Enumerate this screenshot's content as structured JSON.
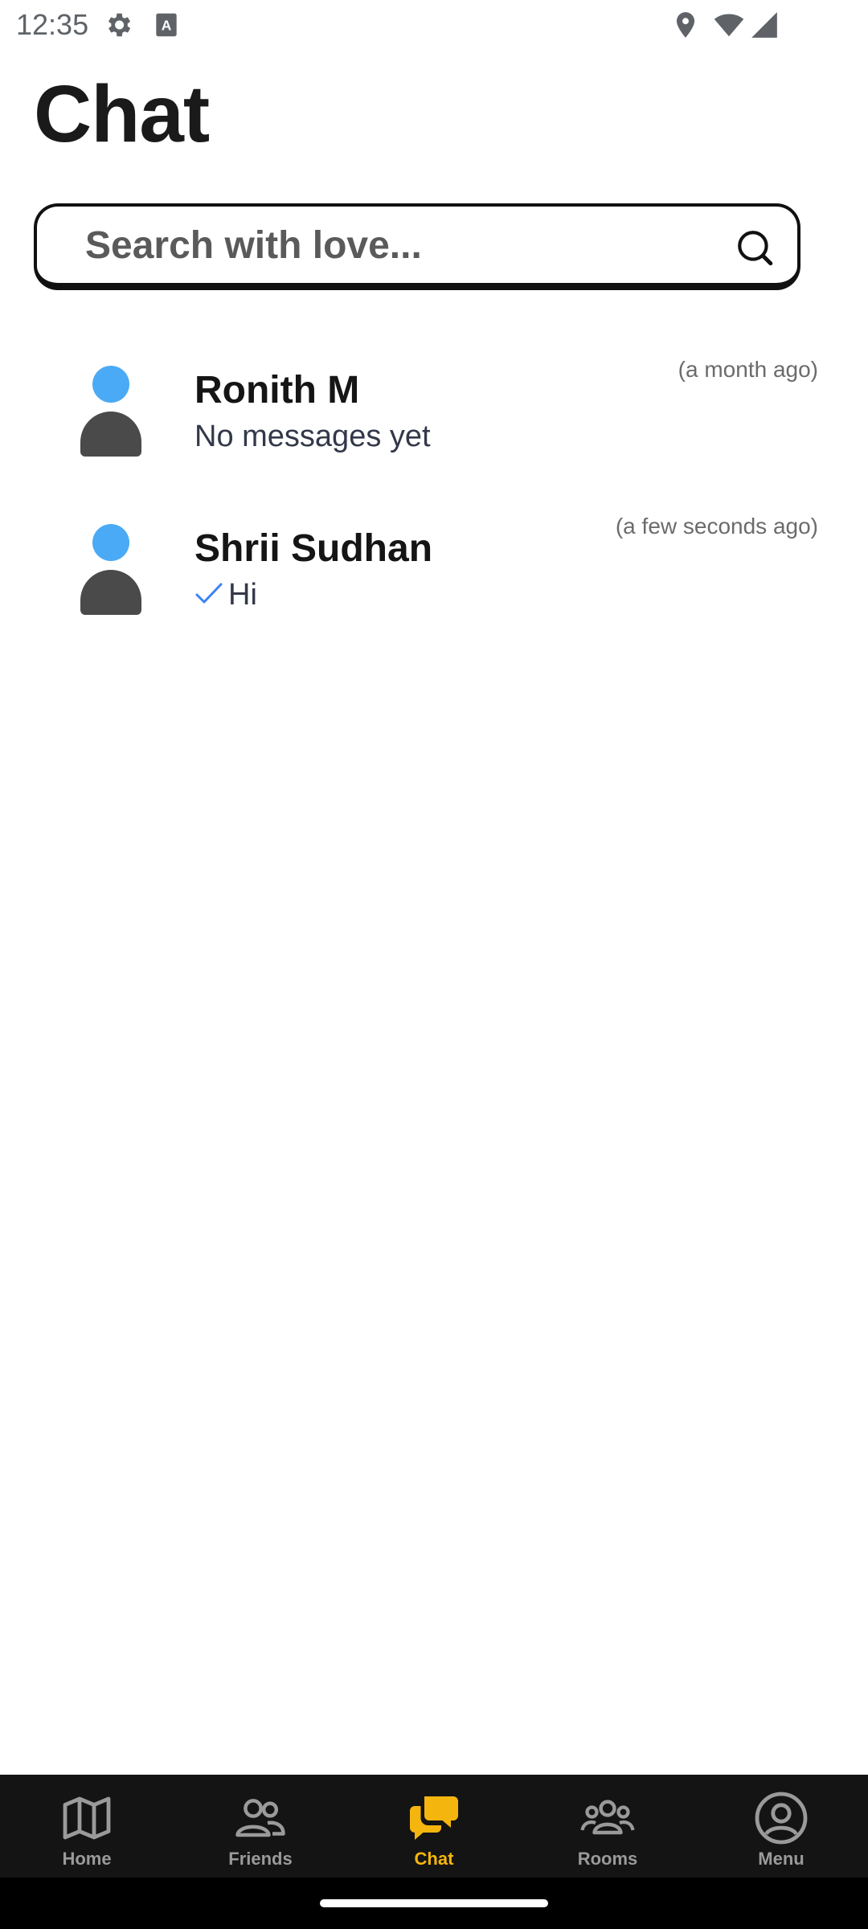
{
  "status_bar": {
    "time": "12:35",
    "icons": [
      "settings-icon",
      "keyboard-a-icon",
      "location-icon",
      "wifi-icon",
      "signal-icon"
    ]
  },
  "page": {
    "title": "Chat"
  },
  "search": {
    "placeholder": "Search with love...",
    "value": ""
  },
  "conversations": [
    {
      "name": "Ronith M",
      "preview": "No messages yet",
      "time": "(a month ago)",
      "read_check": false
    },
    {
      "name": "Shrii Sudhan",
      "preview": "Hi",
      "time": "(a few seconds ago)",
      "read_check": true
    }
  ],
  "nav": {
    "items": [
      {
        "label": "Home",
        "icon": "map-icon",
        "active": false
      },
      {
        "label": "Friends",
        "icon": "friends-icon",
        "active": false
      },
      {
        "label": "Chat",
        "icon": "chat-bubbles-icon",
        "active": true
      },
      {
        "label": "Rooms",
        "icon": "group-icon",
        "active": false
      },
      {
        "label": "Menu",
        "icon": "profile-circle-icon",
        "active": false
      }
    ]
  },
  "colors": {
    "accent": "#f5b50f",
    "nav_background": "#141414",
    "nav_inactive": "#9a9a9a",
    "avatar_head": "#4aaaf5",
    "avatar_body": "#4a4a4a",
    "check": "#3b82f6"
  }
}
